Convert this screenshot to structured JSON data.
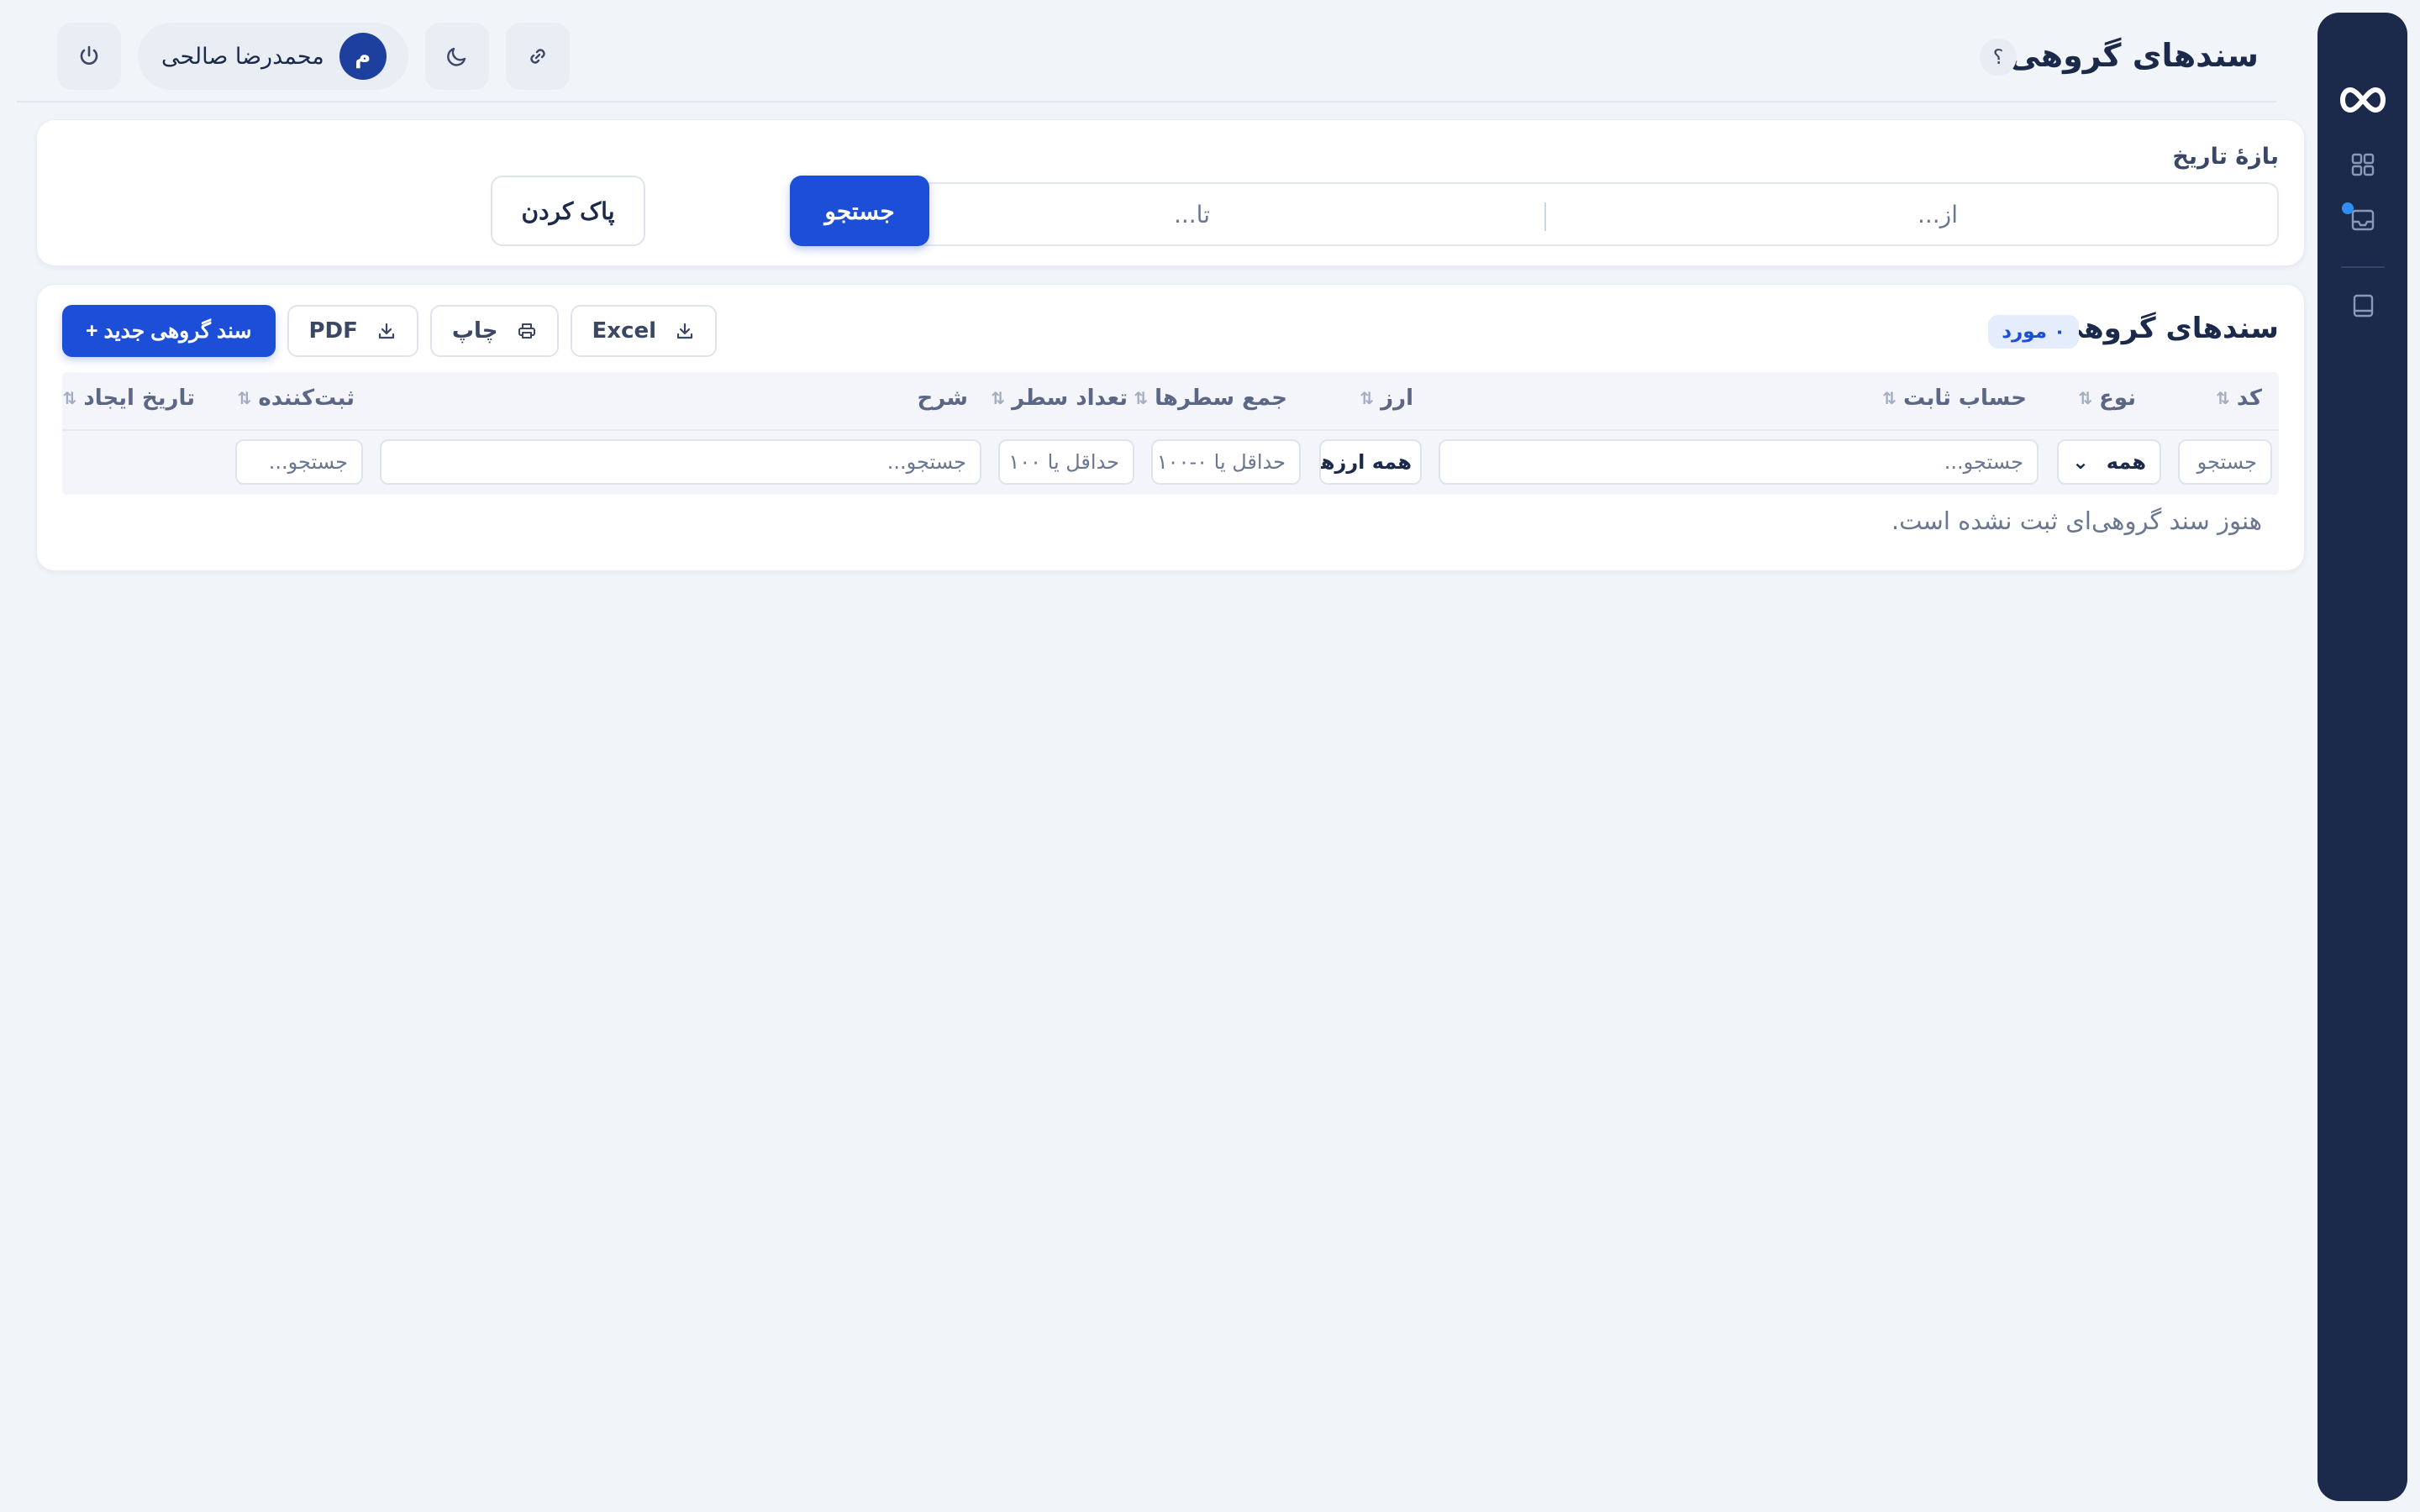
{
  "header": {
    "title": "سندهای گروهی",
    "help_glyph": "؟",
    "user": {
      "initial": "م",
      "name": "محمدرضا صالحی"
    }
  },
  "filters_card": {
    "range_label": "بازهٔ تاریخ",
    "from_placeholder": "از...",
    "to_placeholder": "تا...",
    "search_label": "جستجو",
    "clear_label": "پاک کردن"
  },
  "list": {
    "title": "سندهای گروهی",
    "count_badge": "۰ مورد",
    "actions": {
      "excel": "Excel",
      "print": "چاپ",
      "pdf": "PDF",
      "new": "+ سند گروهی جدید"
    },
    "columns": {
      "code": "کد",
      "type": "نوع",
      "account": "حساب ثابت",
      "currency": "ارز",
      "sum_rows": "جمع سطرها",
      "row_count": "تعداد سطر",
      "description": "شرح",
      "creator": "ثبت‌کننده",
      "created_at": "تاریخ ایجاد"
    },
    "column_filters": {
      "code": "جستجو",
      "type": "همه",
      "account": "جستجو...",
      "currency": "همه ارزها",
      "sum_rows": "حداقل یا ۰-۱۰۰",
      "row_count": "حداقل یا ۱۰۰",
      "description": "جستجو...",
      "creator": "جستجو..."
    },
    "empty_message": "هنوز سند گروهی‌ای ثبت نشده است."
  },
  "colors": {
    "primary": "#1d4ed8",
    "rail": "#1b2a4a",
    "background": "#f1f4f9"
  }
}
